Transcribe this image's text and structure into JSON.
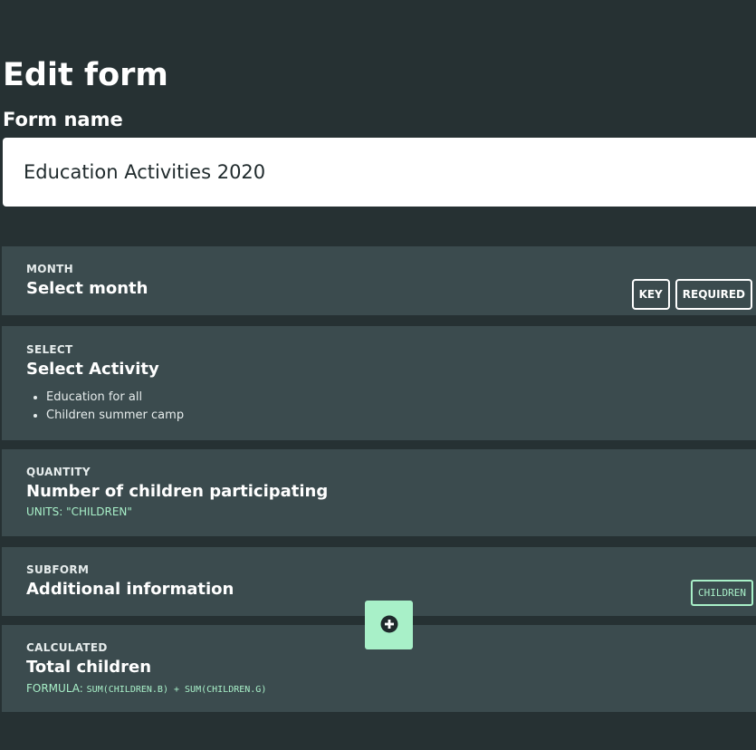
{
  "page": {
    "title": "Edit form",
    "form_name_label": "Form name",
    "form_name_value": "Education Activities 2020"
  },
  "fields": [
    {
      "type": "MONTH",
      "title": "Select month",
      "badges": [
        "KEY",
        "REQUIRED"
      ]
    },
    {
      "type": "SELECT",
      "title": "Select Activity",
      "options": [
        "Education for all",
        "Children summer camp"
      ]
    },
    {
      "type": "QUANTITY",
      "title": "Number of children participating",
      "units": "UNITS: \"CHILDREN\""
    },
    {
      "type": "SUBFORM",
      "title": "Additional information",
      "code_badge": "CHILDREN"
    },
    {
      "type": "CALCULATED",
      "title": "Total children",
      "formula_label": "FORMULA:",
      "formula": "SUM(CHILDREN.B) + SUM(CHILDREN.G)"
    }
  ],
  "add_button": {
    "icon": "plus-circle-icon"
  },
  "colors": {
    "background": "#263133",
    "card": "#3b4b4e",
    "accent": "#a8f0c8"
  }
}
